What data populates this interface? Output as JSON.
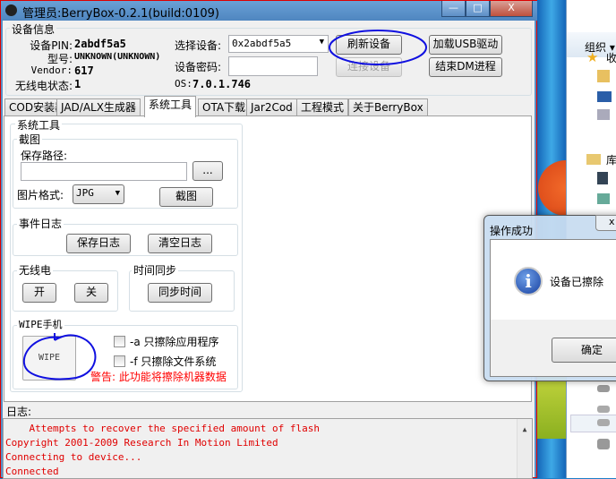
{
  "window": {
    "title": "管理员:BerryBox-0.2.1(build:0109)",
    "minimize": "—",
    "maximize": "□",
    "close": "X"
  },
  "device_info": {
    "group": "设备信息",
    "pin_label": "设备PIN:",
    "pin": "2abdf5a5",
    "model_label": "型号:",
    "model": "UNKNOWN(UNKNOWN)",
    "vendor_label": "Vendor:",
    "vendor": "617",
    "radio_label": "无线电状态:",
    "radio": "1",
    "select_label": "选择设备:",
    "select_value": "0x2abdf5a5",
    "password_label": "设备密码:",
    "password_value": "",
    "os_label": "OS:",
    "os": "7.0.1.746",
    "refresh": "刷新设备",
    "connect": "连接设备",
    "load_usb": "加载USB驱动",
    "end_dm": "结束DM进程"
  },
  "tabs": [
    "COD安装器",
    "JAD/ALX生成器",
    "系统工具",
    "OTA下载",
    "Jar2Cod",
    "工程模式",
    "关于BerryBox"
  ],
  "active_tab": 2,
  "tools": {
    "group": "系统工具",
    "screenshot": {
      "group": "截图",
      "path_label": "保存路径:",
      "path_value": "",
      "browse": "...",
      "format_label": "图片格式:",
      "format": "JPG",
      "capture": "截图"
    },
    "eventlog": {
      "group": "事件日志",
      "save": "保存日志",
      "clear": "清空日志"
    },
    "radio": {
      "group": "无线电",
      "on": "开",
      "off": "关"
    },
    "timesync": {
      "group": "时间同步",
      "sync": "同步时间"
    },
    "wipe": {
      "group": "WIPE手机",
      "button": "WIPE",
      "opt_a": "-a 只擦除应用程序",
      "opt_f": "-f 只擦除文件系统",
      "warning": "警告: 此功能将擦除机器数据",
      "opt_a_checked": false,
      "opt_f_checked": false
    }
  },
  "log": {
    "label": "日志:",
    "lines": [
      "    Attempts to recover the specified amount of flash",
      "Copyright 2001-2009 Research In Motion Limited",
      "Connecting to device...",
      "Connected"
    ]
  },
  "dialog": {
    "title": "操作成功",
    "message": "设备已擦除",
    "ok": "确定",
    "icon": "info-icon"
  },
  "explorer": {
    "organize": "组织 ▾",
    "fav": "收",
    "lib": "库"
  },
  "colors": {
    "warning": "#ff0000",
    "log_text": "#e00000",
    "annotation": "#1010e0"
  }
}
